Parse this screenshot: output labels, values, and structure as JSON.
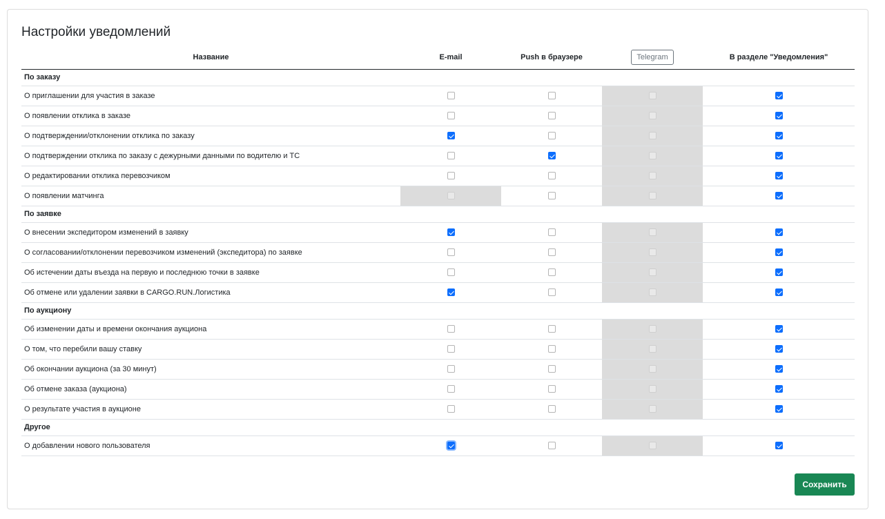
{
  "title": "Настройки уведомлений",
  "columns": {
    "name": "Название",
    "email": "E-mail",
    "push": "Push в браузере",
    "telegram": "Telegram",
    "section": "В разделе \"Уведомления\""
  },
  "groups": [
    {
      "label": "По заказу",
      "rows": [
        {
          "label": "О приглашении для участия в заказе",
          "cells": [
            "off",
            "off",
            "disabled",
            "on"
          ]
        },
        {
          "label": "О появлении отклика в заказе",
          "cells": [
            "off",
            "off",
            "disabled",
            "on"
          ]
        },
        {
          "label": "О подтверждении/отклонении отклика по заказу",
          "cells": [
            "on",
            "off",
            "disabled",
            "on"
          ]
        },
        {
          "label": "О подтверждении отклика по заказу с дежурными данными по водителю и ТС",
          "cells": [
            "off",
            "on",
            "disabled",
            "on"
          ]
        },
        {
          "label": "О редактировании отклика перевозчиком",
          "cells": [
            "off",
            "off",
            "disabled",
            "on"
          ]
        },
        {
          "label": "О появлении матчинга",
          "cells": [
            "disabled",
            "off",
            "disabled",
            "on"
          ]
        }
      ]
    },
    {
      "label": "По заявке",
      "rows": [
        {
          "label": "О внесении экспедитором изменений в заявку",
          "cells": [
            "on",
            "off",
            "disabled",
            "on"
          ]
        },
        {
          "label": "О согласовании/отклонении перевозчиком изменений (экспедитора) по заявке",
          "cells": [
            "off",
            "off",
            "disabled",
            "on"
          ]
        },
        {
          "label": "Об истечении даты въезда на первую и последнюю точки в заявке",
          "cells": [
            "off",
            "off",
            "disabled",
            "on"
          ]
        },
        {
          "label": "Об отмене или удалении заявки в CARGO.RUN.Логистика",
          "cells": [
            "on",
            "off",
            "disabled",
            "on"
          ]
        }
      ]
    },
    {
      "label": "По аукциону",
      "rows": [
        {
          "label": "Об изменении даты и времени окончания аукциона",
          "cells": [
            "off",
            "off",
            "disabled",
            "on"
          ]
        },
        {
          "label": "О том, что перебили вашу ставку",
          "cells": [
            "off",
            "off",
            "disabled",
            "on"
          ]
        },
        {
          "label": "Об окончании аукциона (за 30 минут)",
          "cells": [
            "off",
            "off",
            "disabled",
            "on"
          ]
        },
        {
          "label": "Об отмене заказа (аукциона)",
          "cells": [
            "off",
            "off",
            "disabled",
            "on"
          ]
        },
        {
          "label": "О результате участия в аукционе",
          "cells": [
            "off",
            "off",
            "disabled",
            "on"
          ]
        }
      ]
    },
    {
      "label": "Другое",
      "rows": [
        {
          "label": "О добавлении нового пользователя",
          "cells": [
            "on-focused",
            "off",
            "disabled",
            "on"
          ]
        }
      ]
    }
  ],
  "save_label": "Сохранить",
  "colors": {
    "checkbox_checked": "#0d6efd",
    "disabled_cell": "#dcdcdc",
    "save_button": "#198754"
  }
}
